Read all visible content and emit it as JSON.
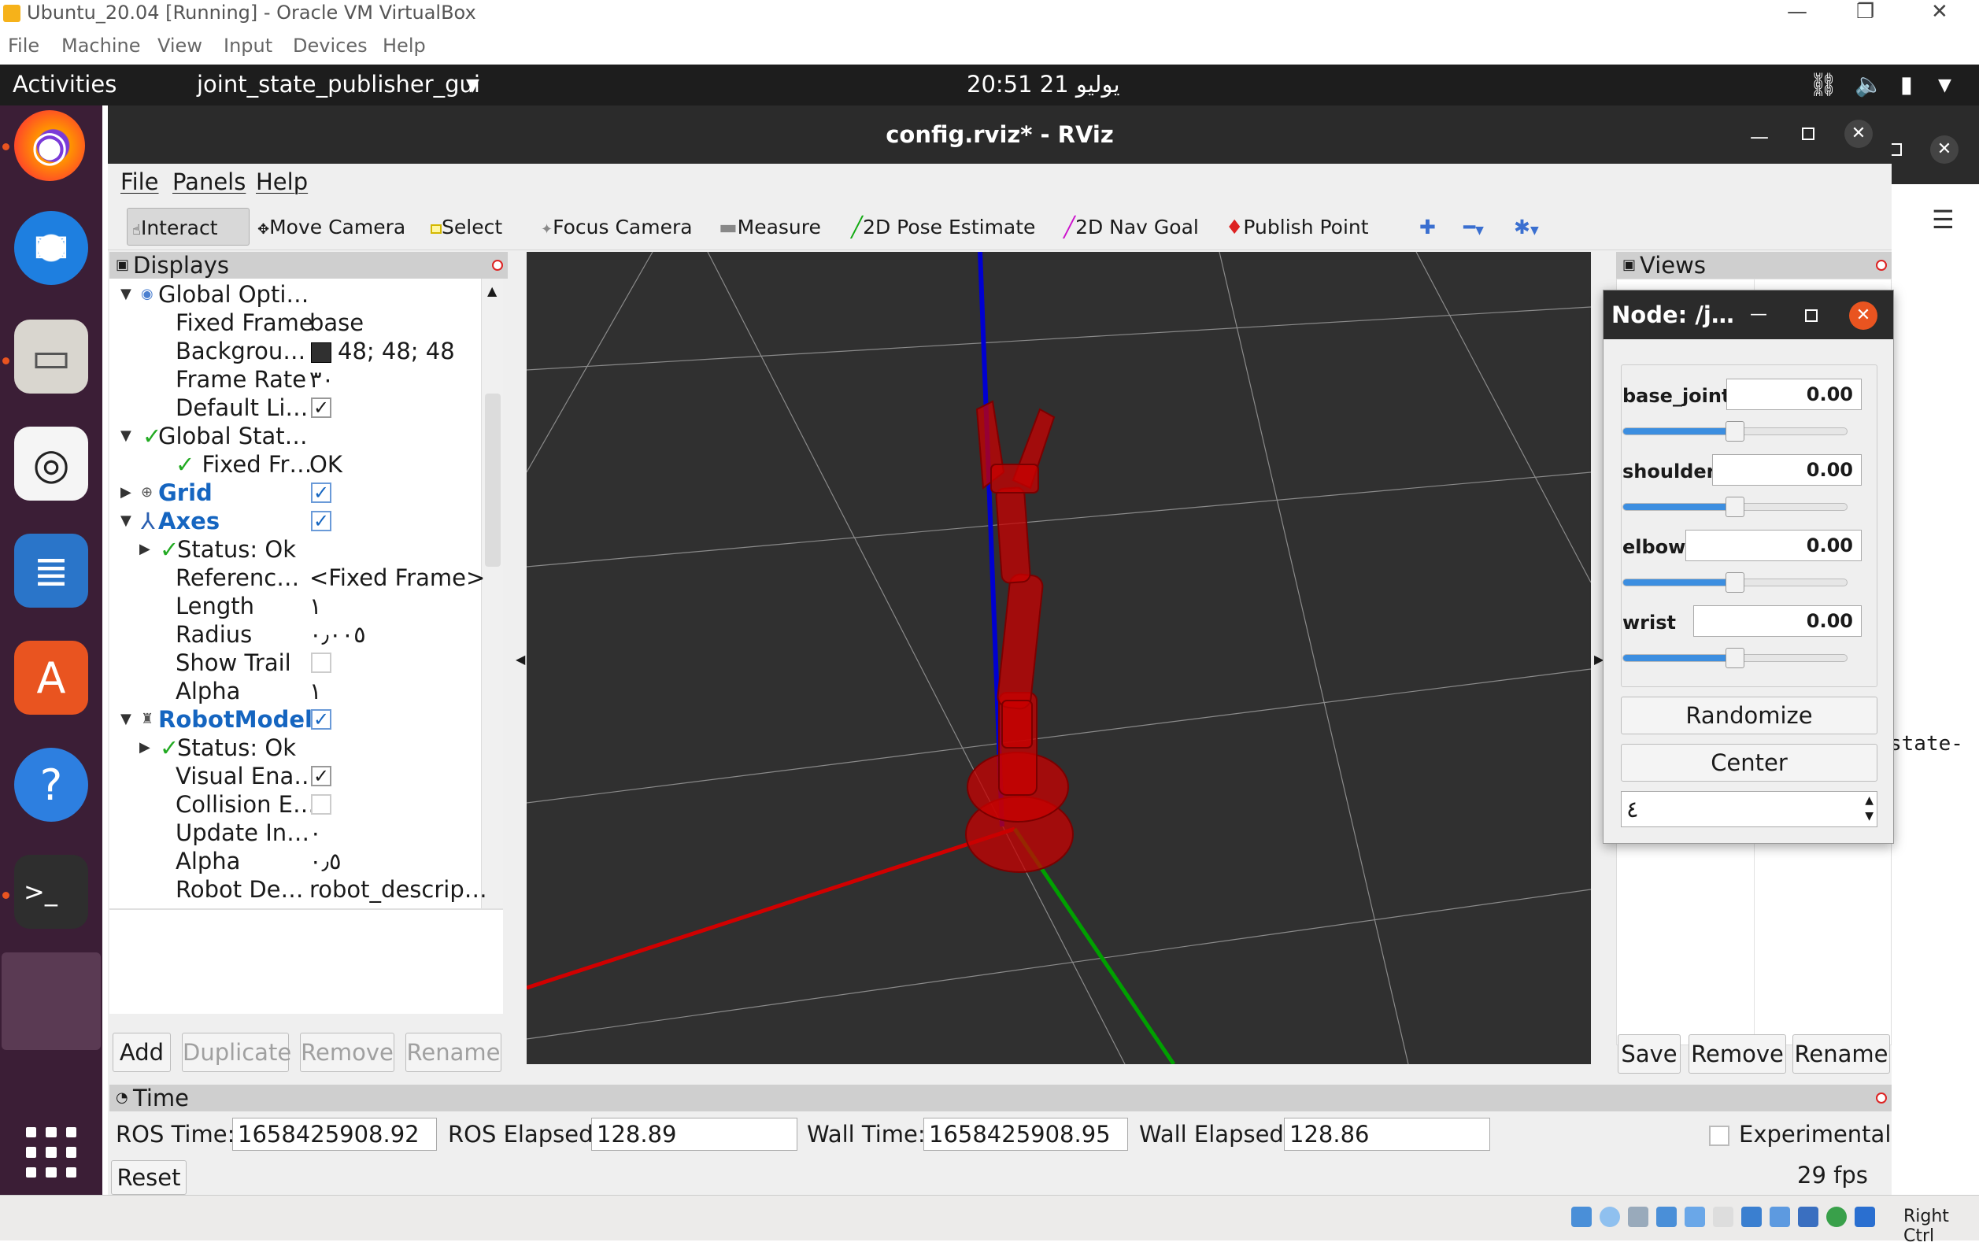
{
  "vbox": {
    "title": "Ubuntu_20.04 [Running] - Oracle VM VirtualBox",
    "menu": [
      "File",
      "Machine",
      "View",
      "Input",
      "Devices",
      "Help"
    ],
    "status_right": "Right Ctrl"
  },
  "topbar": {
    "activities": "Activities",
    "app_name": "joint_state_publisher_gui",
    "clock": "20:51  21 يوليو"
  },
  "bg_terminal_text": "state-",
  "rviz": {
    "title": "config.rviz* - RViz",
    "menu": [
      "File",
      "Panels",
      "Help"
    ],
    "tools": [
      "Interact",
      "Move Camera",
      "Select",
      "Focus Camera",
      "Measure",
      "2D Pose Estimate",
      "2D Nav Goal",
      "Publish Point"
    ],
    "displays_title": "Displays",
    "views_title": "Views",
    "time_title": "Time",
    "tree": {
      "global_options": "Global Opti…",
      "fixed_frame_label": "Fixed Frame",
      "fixed_frame_value": "base",
      "background_label": "Backgrou…",
      "background_value": "48; 48; 48",
      "frame_rate_label": "Frame Rate",
      "frame_rate_value": "٣٠",
      "default_light_label": "Default Li…",
      "global_status": "Global Stat…",
      "fixed_frame_status_label": "Fixed Fr…",
      "fixed_frame_status_value": "OK",
      "grid": "Grid",
      "axes": "Axes",
      "axes_status": "Status: Ok",
      "reference_label": "Referenc…",
      "reference_value": "<Fixed Frame>",
      "length_label": "Length",
      "length_value": "١",
      "radius_label": "Radius",
      "radius_value": "٠٫٠٠٥",
      "show_trail_label": "Show Trail",
      "alpha_label": "Alpha",
      "alpha_value": "١",
      "robot_model": "RobotModel",
      "robot_status": "Status: Ok",
      "visual_label": "Visual Ena…",
      "collision_label": "Collision E…",
      "update_label": "Update In…",
      "update_value": "٠",
      "alpha2_label": "Alpha",
      "alpha2_value": "٠٫٥",
      "robot_desc_label": "Robot De…",
      "robot_desc_value": "robot_descrip…"
    },
    "display_buttons": {
      "add": "Add",
      "duplicate": "Duplicate",
      "remove": "Remove",
      "rename": "Rename"
    },
    "view_buttons": {
      "save": "Save",
      "remove": "Remove",
      "rename": "Rename"
    },
    "time": {
      "ros_time_label": "ROS Time:",
      "ros_time": "1658425908.92",
      "ros_elapsed_label": "ROS Elapsed:",
      "ros_elapsed": "128.89",
      "wall_time_label": "Wall Time:",
      "wall_time": "1658425908.95",
      "wall_elapsed_label": "Wall Elapsed:",
      "wall_elapsed": "128.86",
      "experimental": "Experimental",
      "reset": "Reset",
      "fps": "29 fps"
    }
  },
  "jsp": {
    "title": "Node: /j…",
    "joints": [
      {
        "name": "base_joint",
        "value": "0.00",
        "level": 0.5
      },
      {
        "name": "shoulder",
        "value": "0.00",
        "level": 0.5
      },
      {
        "name": "elbow",
        "value": "0.00",
        "level": 0.5
      },
      {
        "name": "wrist",
        "value": "0.00",
        "level": 0.5
      }
    ],
    "randomize": "Randomize",
    "center": "Center",
    "spin_value": "٤"
  },
  "colors": {
    "scene_bg": "#303030",
    "accent_selected": "#1565c0",
    "robot": "#d40000",
    "axis_x": "#d00000",
    "axis_y": "#00a000",
    "axis_z": "#0000d0",
    "ubuntu_orange": "#e95420"
  }
}
